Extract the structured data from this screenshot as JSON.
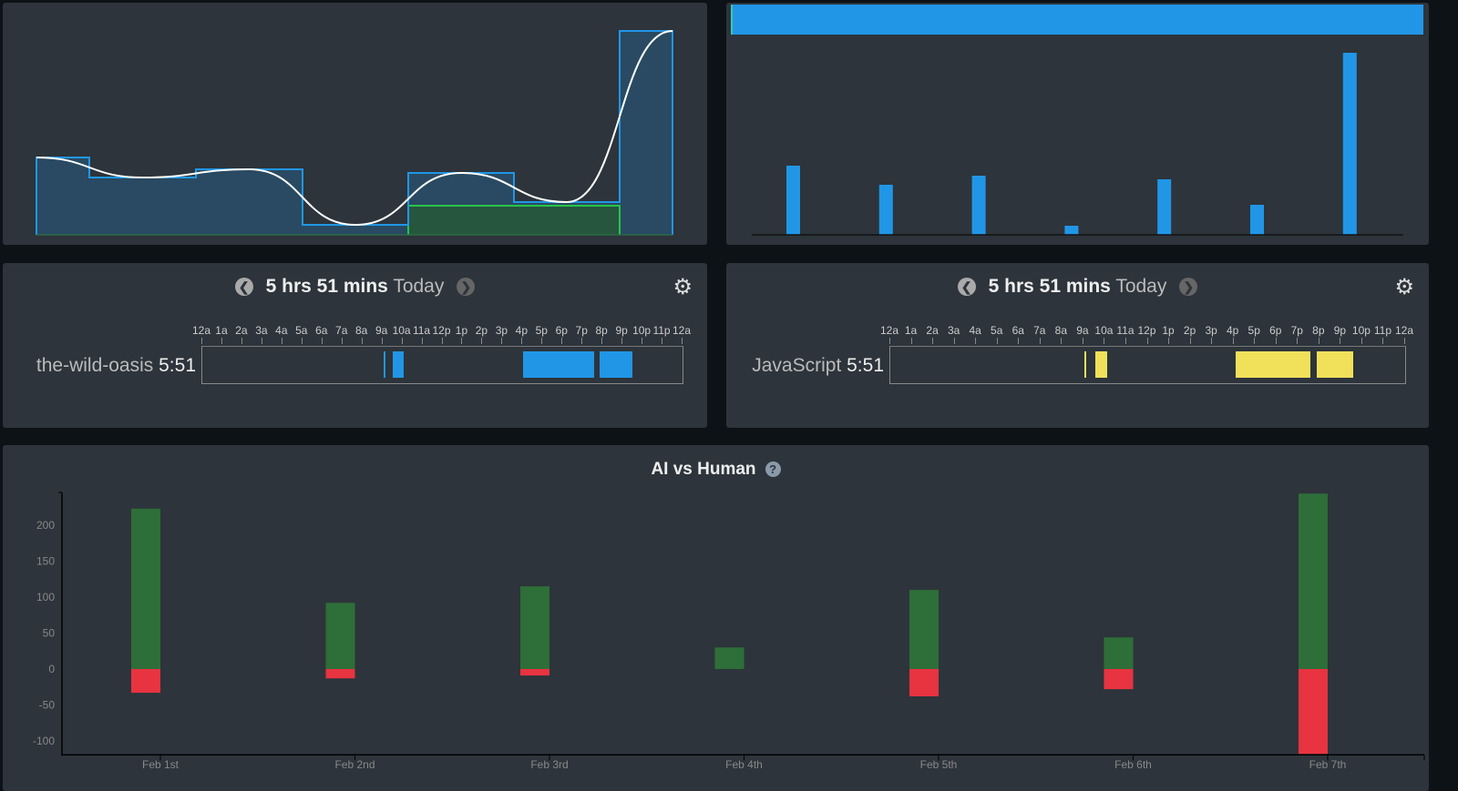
{
  "top_left_chart": {
    "type": "area",
    "step_values": [
      85,
      63,
      72,
      11,
      68,
      36,
      224
    ],
    "green_segment": {
      "from_index": 4,
      "to_index": 5,
      "value": 32
    },
    "colors": {
      "step_line": "#2196e6",
      "fill": "#294a62",
      "curve": "#ffffff",
      "green": "#27c44a",
      "green_fill": "#27563f"
    }
  },
  "top_right_chart": {
    "type": "bar",
    "progress_fill": 1.0,
    "values": [
      76,
      55,
      65,
      10,
      61,
      33,
      200
    ],
    "color": "#2196e6"
  },
  "project_panel": {
    "duration": "5 hrs 51 mins",
    "period": "Today",
    "row_label": "the-wild-oasis",
    "row_time": "5:51",
    "blocks_hours": [
      [
        9.05,
        9.12
      ],
      [
        9.5,
        10.05
      ],
      [
        16.05,
        19.6
      ],
      [
        19.85,
        21.5
      ]
    ],
    "color": "#2196e6"
  },
  "language_panel": {
    "duration": "5 hrs 51 mins",
    "period": "Today",
    "row_label": "JavaScript",
    "row_time": "5:51",
    "blocks_hours": [
      [
        9.05,
        9.15
      ],
      [
        9.55,
        10.1
      ],
      [
        16.1,
        19.6
      ],
      [
        19.9,
        21.6
      ]
    ],
    "color": "#f0e05a"
  },
  "hour_labels": [
    "12a",
    "1a",
    "2a",
    "3a",
    "4a",
    "5a",
    "6a",
    "7a",
    "8a",
    "9a",
    "10a",
    "11a",
    "12p",
    "1p",
    "2p",
    "3p",
    "4p",
    "5p",
    "6p",
    "7p",
    "8p",
    "9p",
    "10p",
    "11p",
    "12a"
  ],
  "chart_data": {
    "type": "bar",
    "title": "AI vs Human",
    "categories": [
      "Feb 1st",
      "Feb 2nd",
      "Feb 3rd",
      "Feb 4th",
      "Feb 5th",
      "Feb 6th",
      "Feb 7th"
    ],
    "series": [
      {
        "values": [
          223,
          92,
          115,
          30,
          110,
          44,
          244
        ],
        "color": "#2e6e38"
      },
      {
        "values": [
          -33,
          -13,
          -9,
          0,
          -38,
          -28,
          -118
        ],
        "color": "#e83340"
      }
    ],
    "yticks": [
      200,
      150,
      100,
      50,
      0,
      -50,
      -100
    ],
    "ylim": [
      -118,
      245
    ],
    "grid": false
  }
}
